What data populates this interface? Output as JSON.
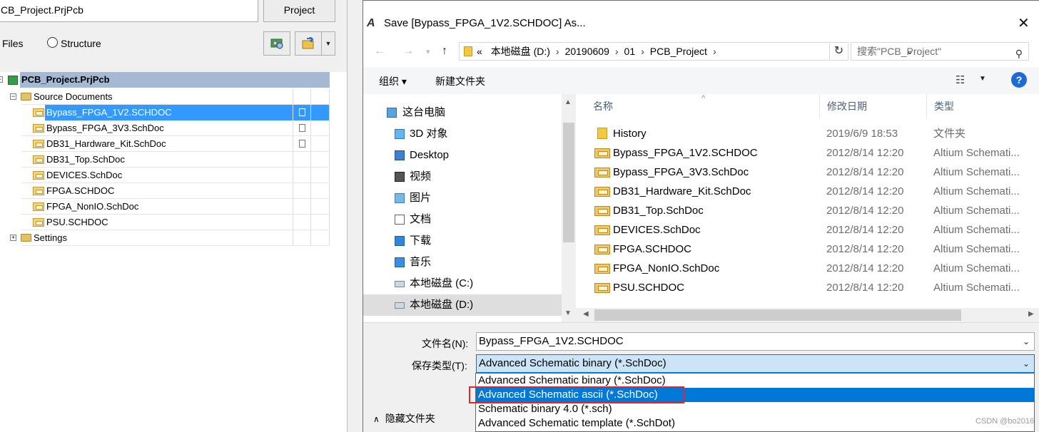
{
  "left_panel": {
    "project_field": "CB_Project.PrjPcb",
    "project_button": "Project",
    "radio_files": "Files",
    "radio_structure": "Structure",
    "tree": {
      "root": "PCB_Project.PrjPcb",
      "source_folder": "Source Documents",
      "documents": [
        "Bypass_FPGA_1V2.SCHDOC",
        "Bypass_FPGA_3V3.SchDoc",
        "DB31_Hardware_Kit.SchDoc",
        "DB31_Top.SchDoc",
        "DEVICES.SchDoc",
        "FPGA.SCHDOC",
        "FPGA_NonIO.SchDoc",
        "PSU.SCHDOC"
      ],
      "settings_folder": "Settings"
    }
  },
  "dialog": {
    "app_icon": "A",
    "title": "Save [Bypass_FPGA_1V2.SCHDOC] As...",
    "close": "✕",
    "address": {
      "crumbs_prefix": "«",
      "crumbs": [
        "本地磁盘 (D:)",
        "20190609",
        "01",
        "PCB_Project"
      ],
      "search_placeholder": "搜索\"PCB_Project\""
    },
    "toolbar": {
      "organize": "组织 ▾",
      "new_folder": "新建文件夹",
      "help": "?"
    },
    "nav": [
      "这台电脑",
      "3D 对象",
      "Desktop",
      "视频",
      "图片",
      "文档",
      "下载",
      "音乐",
      "本地磁盘 (C:)",
      "本地磁盘 (D:)"
    ],
    "columns": {
      "name": "名称",
      "date": "修改日期",
      "type": "类型"
    },
    "files": [
      {
        "name": "History",
        "date": "2019/6/9 18:53",
        "type": "文件夹",
        "kind": "folder"
      },
      {
        "name": "Bypass_FPGA_1V2.SCHDOC",
        "date": "2012/8/14 12:20",
        "type": "Altium Schemati...",
        "kind": "sch"
      },
      {
        "name": "Bypass_FPGA_3V3.SchDoc",
        "date": "2012/8/14 12:20",
        "type": "Altium Schemati...",
        "kind": "sch"
      },
      {
        "name": "DB31_Hardware_Kit.SchDoc",
        "date": "2012/8/14 12:20",
        "type": "Altium Schemati...",
        "kind": "sch"
      },
      {
        "name": "DB31_Top.SchDoc",
        "date": "2012/8/14 12:20",
        "type": "Altium Schemati...",
        "kind": "sch"
      },
      {
        "name": "DEVICES.SchDoc",
        "date": "2012/8/14 12:20",
        "type": "Altium Schemati...",
        "kind": "sch"
      },
      {
        "name": "FPGA.SCHDOC",
        "date": "2012/8/14 12:20",
        "type": "Altium Schemati...",
        "kind": "sch"
      },
      {
        "name": "FPGA_NonIO.SchDoc",
        "date": "2012/8/14 12:20",
        "type": "Altium Schemati...",
        "kind": "sch"
      },
      {
        "name": "PSU.SCHDOC",
        "date": "2012/8/14 12:20",
        "type": "Altium Schemati...",
        "kind": "sch"
      }
    ],
    "filename_label": "文件名(N):",
    "filename_value": "Bypass_FPGA_1V2.SCHDOC",
    "savetype_label": "保存类型(T):",
    "savetype_value": "Advanced Schematic binary (*.SchDoc)",
    "savetype_options": [
      "Advanced Schematic binary (*.SchDoc)",
      "Advanced Schematic ascii (*.SchDoc)",
      "Schematic binary 4.0 (*.sch)",
      "Advanced Schematic template (*.SchDot)"
    ],
    "hide_folders": "隐藏文件夹"
  },
  "watermark": "CSDN @bo2016",
  "colors": {
    "selection": "#3399ff",
    "dropdown_highlight": "#0078d7",
    "annotation_box": "#e0282b"
  }
}
